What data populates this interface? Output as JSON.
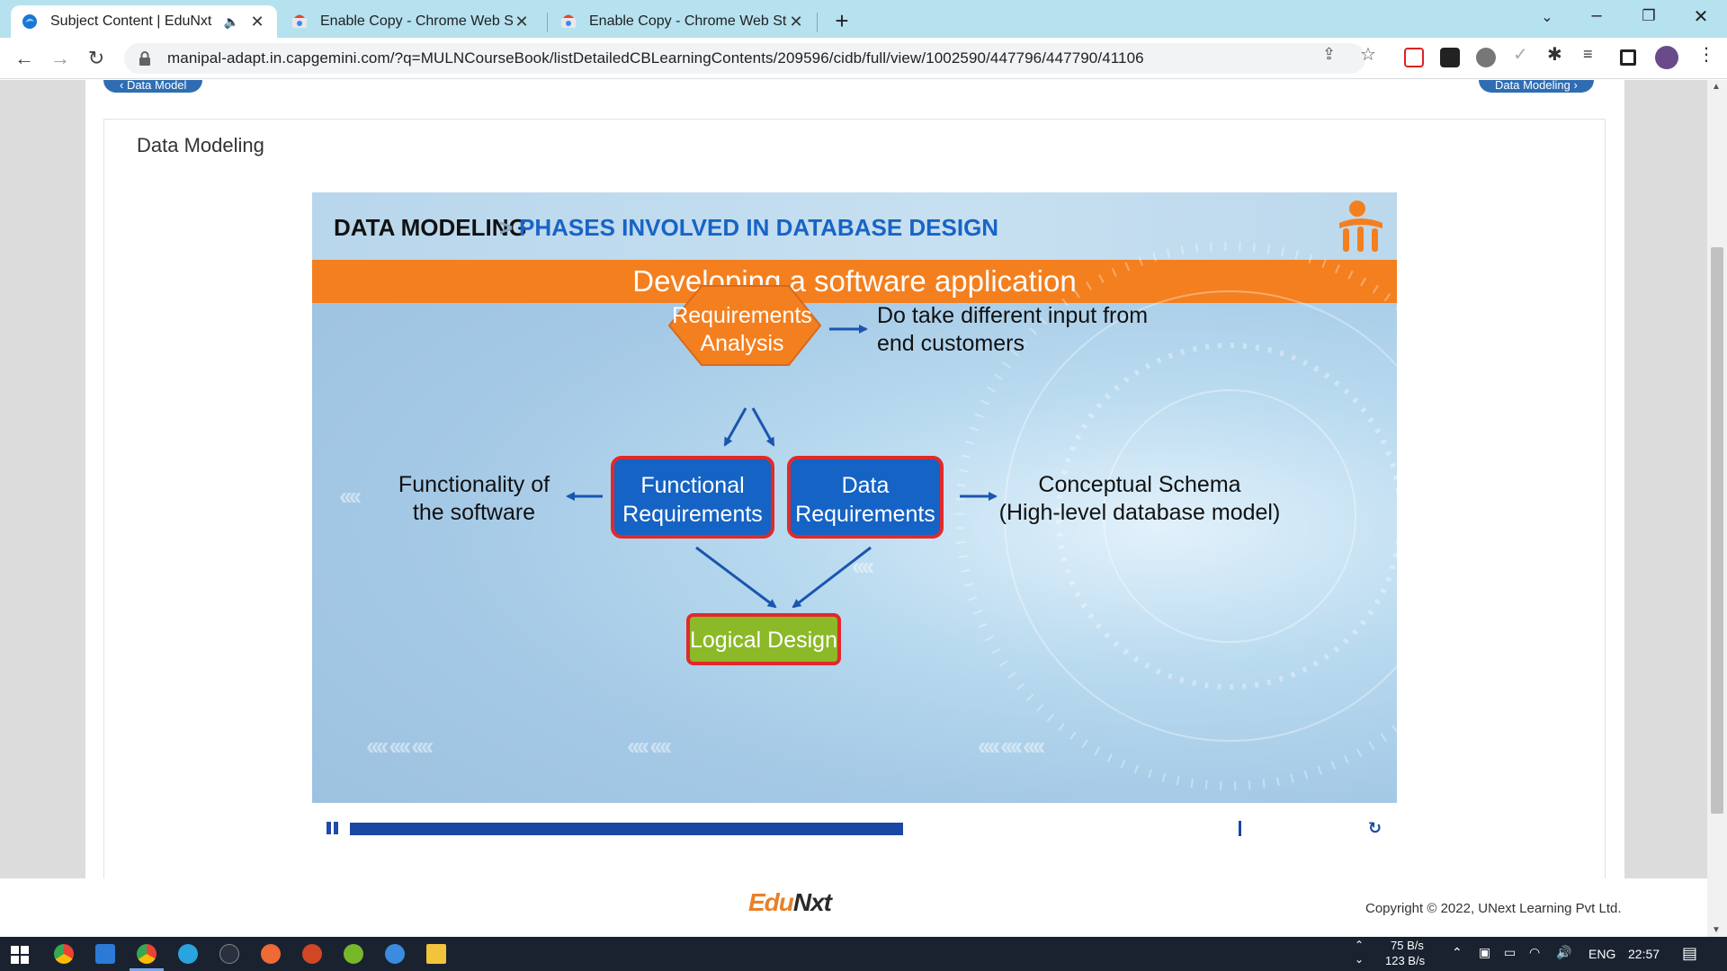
{
  "browser": {
    "tabs": [
      {
        "title": "Subject Content | EduNxt",
        "active": true,
        "audio": true
      },
      {
        "title": "Enable Copy - Chrome Web Store",
        "active": false
      },
      {
        "title": "Enable Copy - Chrome Web Store",
        "active": false
      }
    ],
    "url": "manipal-adapt.in.capgemini.com/?q=MULNCourseBook/listDetailedCBLearningContents/209596/cidb/full/view/1002590/447796/447790/41106"
  },
  "page": {
    "prev_link": "‹ Data Model",
    "next_link": "Data Modeling ›",
    "title": "Data Modeling"
  },
  "slide": {
    "heading_main": "DATA MODELING",
    "heading_sep": ">",
    "heading_sub": "PHASES INVOLVED IN DATABASE DESIGN",
    "banner": "Developing a software application",
    "nodes": {
      "requirements_line1": "Requirements",
      "requirements_line2": "Analysis",
      "functional_line1": "Functional",
      "functional_line2": "Requirements",
      "data_line1": "Data",
      "data_line2": "Requirements",
      "logical": "Logical Design"
    },
    "notes": {
      "input_line1": "Do take different input from",
      "input_line2": "end customers",
      "functionality_line1": "Functionality of",
      "functionality_line2": "the software",
      "schema_line1": "Conceptual Schema",
      "schema_line2": "(High-level database model)"
    },
    "colors": {
      "orange": "#f47f1f",
      "blue_node": "#1563c4",
      "green_node": "#8cb928",
      "red_border": "#e02a2a",
      "arrow": "#1a56b0"
    }
  },
  "player": {
    "progress_fraction": 0.567
  },
  "footer": {
    "brand_part1": "Edu",
    "brand_part2": "Nxt",
    "copyright": "Copyright © 2022, UNext Learning Pvt Ltd."
  },
  "taskbar": {
    "net_up": "75 B/s",
    "net_down": "123 B/s",
    "language": "ENG",
    "time": "22:57"
  }
}
